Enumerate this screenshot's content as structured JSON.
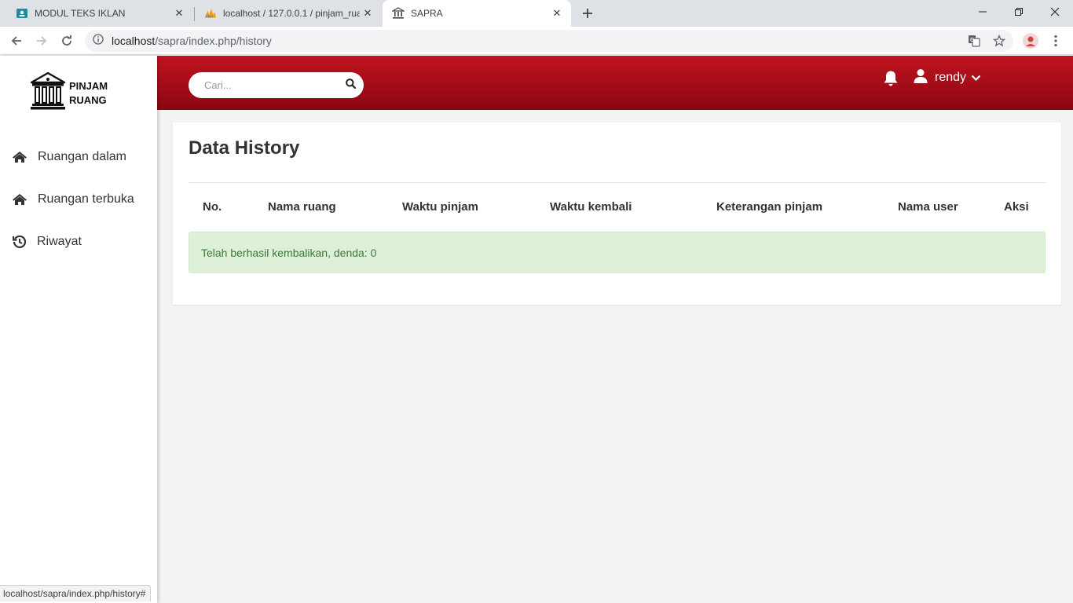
{
  "browser": {
    "tabs": [
      {
        "title": "MODUL TEKS IKLAN",
        "icon": "classroom-icon"
      },
      {
        "title": "localhost / 127.0.0.1 / pinjam_rua",
        "icon": "phpmyadmin-icon"
      },
      {
        "title": "SAPRA",
        "icon": "bank-icon",
        "active": true
      }
    ],
    "address": {
      "host": "localhost",
      "path": "/sapra/index.php/history"
    },
    "status_url": "localhost/sapra/index.php/history#"
  },
  "app": {
    "logo": {
      "line1": "PINJAM",
      "line2": "RUANG"
    },
    "sidebar": {
      "items": [
        {
          "label": "Ruangan dalam",
          "icon": "home-icon"
        },
        {
          "label": "Ruangan terbuka",
          "icon": "home-icon"
        },
        {
          "label": "Riwayat",
          "icon": "history-icon"
        }
      ]
    },
    "header": {
      "search_placeholder": "Cari...",
      "username": "rendy"
    },
    "main": {
      "title": "Data History",
      "columns": [
        "No.",
        "Nama ruang",
        "Waktu pinjam",
        "Waktu kembali",
        "Keterangan pinjam",
        "Nama user",
        "Aksi"
      ],
      "alert": "Telah berhasil kembalikan, denda: 0"
    }
  },
  "colors": {
    "header_top": "#c0141f",
    "header_bottom": "#8a0611",
    "alert_bg": "#dff0d8",
    "alert_text": "#3c763d"
  }
}
